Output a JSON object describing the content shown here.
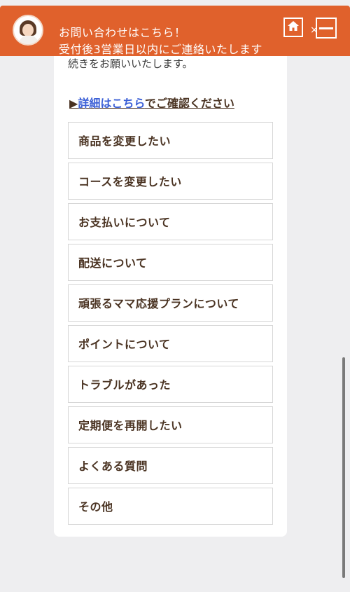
{
  "header": {
    "line1": "お問い合わせはこちら！",
    "line2": "受付後3営業日以内にご連絡いたします",
    "close_symbol": "×",
    "icons": {
      "avatar": "operator-avatar",
      "home": "home-icon",
      "minimize": "minimize-icon"
    },
    "color": "#e0612c"
  },
  "card": {
    "intro_text": "続きをお願いいたします。",
    "details": {
      "arrow": "▶",
      "link": "詳細はこちら",
      "suffix": "でご確認ください"
    },
    "menu_items": [
      {
        "label": "商品を変更したい"
      },
      {
        "label": "コースを変更したい"
      },
      {
        "label": "お支払いについて"
      },
      {
        "label": "配送について"
      },
      {
        "label": "頑張るママ応援プランについて"
      },
      {
        "label": "ポイントについて"
      },
      {
        "label": "トラブルがあった"
      },
      {
        "label": "定期便を再開したい"
      },
      {
        "label": "よくある質問"
      },
      {
        "label": "その他"
      }
    ]
  },
  "colors": {
    "accent": "#e0612c",
    "text": "#4a3322",
    "link": "#3b5fd6",
    "background": "#eeeef0"
  }
}
